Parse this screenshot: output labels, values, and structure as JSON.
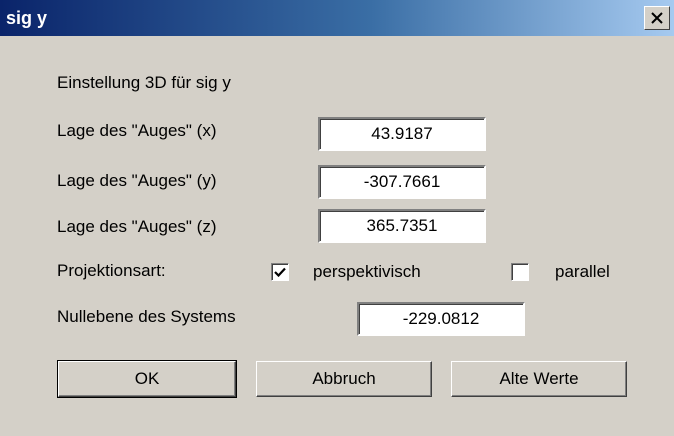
{
  "window": {
    "title": "sig y",
    "close_icon": "close-icon"
  },
  "dialog": {
    "heading": "Einstellung 3D für sig y",
    "eye_x_label": "Lage des \"Auges\" (x)",
    "eye_x_value": "43.9187",
    "eye_y_label": "Lage des \"Auges\" (y)",
    "eye_y_value": "-307.7661",
    "eye_z_label": "Lage des \"Auges\" (z)",
    "eye_z_value": "365.7351",
    "projection_label": "Projektionsart:",
    "perspective_label": "perspektivisch",
    "perspective_checked": true,
    "parallel_label": "parallel",
    "parallel_checked": false,
    "zero_plane_label": "Nullebene des Systems",
    "zero_plane_value": "-229.0812"
  },
  "buttons": {
    "ok_label": "OK",
    "cancel_label": "Abbruch",
    "old_values_label": "Alte Werte"
  }
}
